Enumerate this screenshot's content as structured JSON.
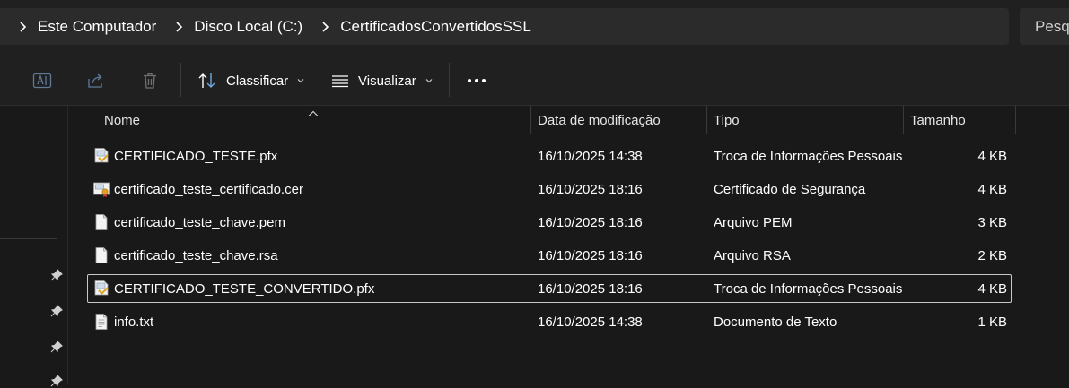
{
  "breadcrumb": {
    "items": [
      "Este Computador",
      "Disco Local (C:)",
      "CertificadosConvertidosSSL"
    ]
  },
  "search": {
    "placeholder": "Pesquisar"
  },
  "commandbar": {
    "sort_label": "Classificar",
    "view_label": "Visualizar"
  },
  "columns": {
    "name": "Nome",
    "modified": "Data de modificação",
    "type": "Tipo",
    "size": "Tamanho"
  },
  "files": [
    {
      "name": "CERTIFICADO_TESTE.pfx",
      "modified": "16/10/2025 14:38",
      "type": "Troca de Informações Pessoais",
      "size": "4 KB",
      "icon": "pfx-file-icon"
    },
    {
      "name": "certificado_teste_certificado.cer",
      "modified": "16/10/2025 18:16",
      "type": "Certificado de Segurança",
      "size": "4 KB",
      "icon": "certificate-file-icon"
    },
    {
      "name": "certificado_teste_chave.pem",
      "modified": "16/10/2025 18:16",
      "type": "Arquivo PEM",
      "size": "3 KB",
      "icon": "document-file-icon"
    },
    {
      "name": "certificado_teste_chave.rsa",
      "modified": "16/10/2025 18:16",
      "type": "Arquivo RSA",
      "size": "2 KB",
      "icon": "document-file-icon"
    },
    {
      "name": "CERTIFICADO_TESTE_CONVERTIDO.pfx",
      "modified": "16/10/2025 18:16",
      "type": "Troca de Informações Pessoais",
      "size": "4 KB",
      "icon": "pfx-file-icon",
      "selected": true
    },
    {
      "name": "info.txt",
      "modified": "16/10/2025 14:38",
      "type": "Documento de Texto",
      "size": "1 KB",
      "icon": "text-file-icon"
    }
  ],
  "colors": {
    "background": "#191919",
    "toolbar": "#202020",
    "address_bg": "#2b2b2b",
    "text": "#ffffff",
    "selection_border": "#c8c8c8"
  }
}
